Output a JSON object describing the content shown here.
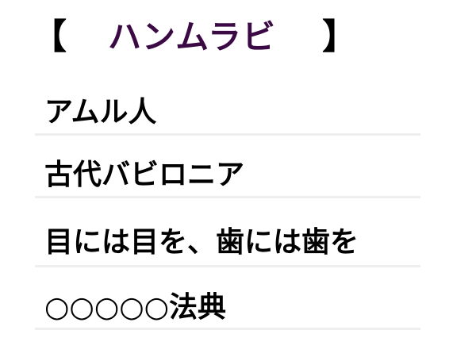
{
  "header": {
    "open_bracket": "【",
    "title": "ハンムラビ",
    "close_bracket": "】",
    "title_color": "#3b0a45"
  },
  "items": [
    {
      "text": "アムル人"
    },
    {
      "text": "古代バビロニア"
    },
    {
      "text": "目には目を、歯には歯を"
    },
    {
      "text": "○○○○○法典"
    }
  ]
}
